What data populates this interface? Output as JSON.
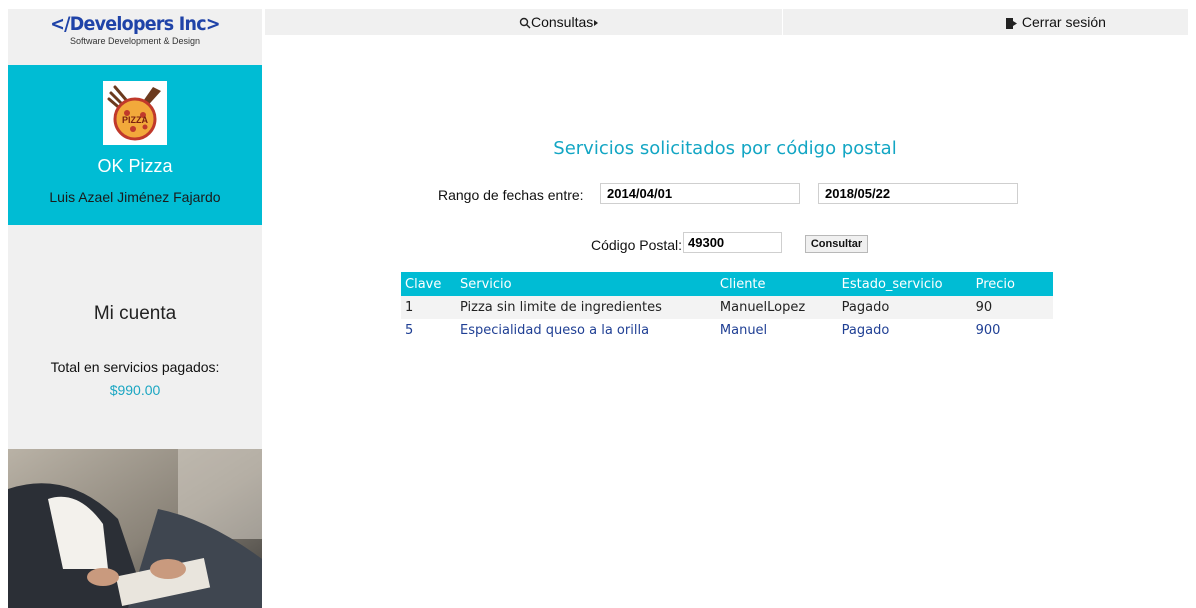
{
  "brand": {
    "title": "</Developers Inc>",
    "subtitle": "Software Development & Design"
  },
  "profile": {
    "logo_icon": "pizza-logo-icon",
    "business_name": "OK Pizza",
    "user_name": "Luis Azael Jiménez Fajardo"
  },
  "account": {
    "title": "Mi cuenta",
    "total_label": "Total en servicios pagados:",
    "total_value": "$990.00"
  },
  "nav": {
    "consultas_label": "Consultas",
    "consultas_icon": "search-icon",
    "consultas_arrow_icon": "caret-right-icon",
    "logout_label": "Cerrar sesión",
    "logout_icon": "sign-out-icon"
  },
  "main": {
    "title": "Servicios solicitados por código postal",
    "date_range_label": "Rango de fechas entre:",
    "date_from": "2014/04/01",
    "date_to": "2018/05/22",
    "postal_code_label": "Código Postal:",
    "postal_code": "49300",
    "submit_label": "Consultar"
  },
  "table": {
    "headers": [
      "Clave",
      "Servicio",
      "Cliente",
      "Estado_servicio",
      "Precio"
    ],
    "rows": [
      [
        "1",
        "Pizza sin limite de ingredientes",
        "ManuelLopez",
        "Pagado",
        "90"
      ],
      [
        "5",
        "Especialidad queso a la orilla",
        "Manuel",
        "Pagado",
        "900"
      ]
    ]
  },
  "colors": {
    "accent": "#00bcd4",
    "brand": "#1f43a8",
    "link": "#1f3f94",
    "sidebar_bg": "#f0f0f0"
  }
}
